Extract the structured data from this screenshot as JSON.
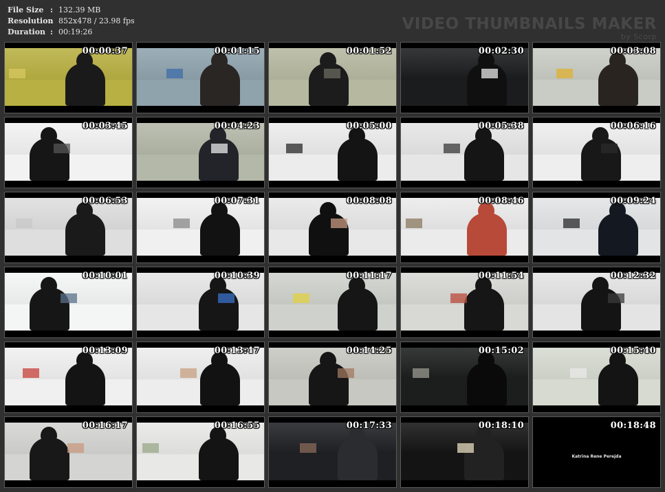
{
  "info": {
    "file_size_label": "File Size",
    "file_size_value": "132.39 MB",
    "resolution_label": "Resolution",
    "resolution_value": "852x478 / 23.98 fps",
    "duration_label": "Duration",
    "duration_value": "00:19:26",
    "colon": ":"
  },
  "brand": {
    "title": "VIDEO THUMBNAILS MAKER",
    "subtitle": "by Scorp"
  },
  "thumbnails": [
    {
      "time": "00:00:37",
      "bg": "#b8b042",
      "fg": "#1a1a1a",
      "accent": "#d8c860"
    },
    {
      "time": "00:01:15",
      "bg": "#8fa3ad",
      "fg": "#2a2624",
      "accent": "#3d6ea8"
    },
    {
      "time": "00:01:52",
      "bg": "#b6b8a0",
      "fg": "#1c1c1c",
      "accent": "#6a6a60"
    },
    {
      "time": "00:02:30",
      "bg": "#1a1c1e",
      "fg": "#101010",
      "accent": "#e8e8e8"
    },
    {
      "time": "00:03:08",
      "bg": "#c8ccc4",
      "fg": "#2a2420",
      "accent": "#e0b030"
    },
    {
      "time": "00:03:45",
      "bg": "#f2f2f2",
      "fg": "#161616",
      "accent": "#555555"
    },
    {
      "time": "00:04:23",
      "bg": "#b4b8a8",
      "fg": "#22242a",
      "accent": "#e8e8e8"
    },
    {
      "time": "00:05:00",
      "bg": "#ececec",
      "fg": "#141414",
      "accent": "#2a2a2a"
    },
    {
      "time": "00:05:38",
      "bg": "#e6e6e6",
      "fg": "#151515",
      "accent": "#3a3a3a"
    },
    {
      "time": "00:06:16",
      "bg": "#eeeeee",
      "fg": "#181818",
      "accent": "#2a2a2a"
    },
    {
      "time": "00:06:53",
      "bg": "#dedede",
      "fg": "#1a1a1a",
      "accent": "#c8c8c8"
    },
    {
      "time": "00:07:31",
      "bg": "#f0f0f0",
      "fg": "#121212",
      "accent": "#8a8a8a"
    },
    {
      "time": "00:08:08",
      "bg": "#e8e8e8",
      "fg": "#101010",
      "accent": "#c89a80"
    },
    {
      "time": "00:08:46",
      "bg": "#ebebeb",
      "fg": "#b84a3a",
      "accent": "#8a7a60"
    },
    {
      "time": "00:09:24",
      "bg": "#e2e4e6",
      "fg": "#141820",
      "accent": "#2a2a2a"
    },
    {
      "time": "00:10:01",
      "bg": "#f4f6f6",
      "fg": "#161616",
      "accent": "#5a7088"
    },
    {
      "time": "00:10:39",
      "bg": "#e6e6e6",
      "fg": "#161616",
      "accent": "#3a72c8"
    },
    {
      "time": "00:11:17",
      "bg": "#cfd2cc",
      "fg": "#161616",
      "accent": "#e0d040"
    },
    {
      "time": "00:11:54",
      "bg": "#d8d8d4",
      "fg": "#161616",
      "accent": "#b84a3a"
    },
    {
      "time": "00:12:32",
      "bg": "#e4e4e4",
      "fg": "#141414",
      "accent": "#3a3a3a"
    },
    {
      "time": "00:13:09",
      "bg": "#f0f0f0",
      "fg": "#141414",
      "accent": "#c8403a"
    },
    {
      "time": "00:13:47",
      "bg": "#ededed",
      "fg": "#121212",
      "accent": "#c8a080"
    },
    {
      "time": "00:14:25",
      "bg": "#c8c8c2",
      "fg": "#161616",
      "accent": "#a07860"
    },
    {
      "time": "00:15:02",
      "bg": "#1c1e1e",
      "fg": "#0a0a0a",
      "accent": "#9a9a90"
    },
    {
      "time": "00:15:40",
      "bg": "#d6dad0",
      "fg": "#141414",
      "accent": "#eaeaea"
    },
    {
      "time": "00:16:17",
      "bg": "#d4d4d2",
      "fg": "#181818",
      "accent": "#c89a80"
    },
    {
      "time": "00:16:55",
      "bg": "#e8e8e6",
      "fg": "#141414",
      "accent": "#9aa88a"
    },
    {
      "time": "00:17:33",
      "bg": "#1e2024",
      "fg": "#2a2c30",
      "accent": "#8a6a5a"
    },
    {
      "time": "00:18:10",
      "bg": "#141414",
      "fg": "#222222",
      "accent": "#e8dcc0"
    },
    {
      "time": "00:18:48",
      "bg": "#000000",
      "fg": "#000000",
      "accent": "#000000",
      "credit": "Katrina Rene Perejda"
    }
  ]
}
